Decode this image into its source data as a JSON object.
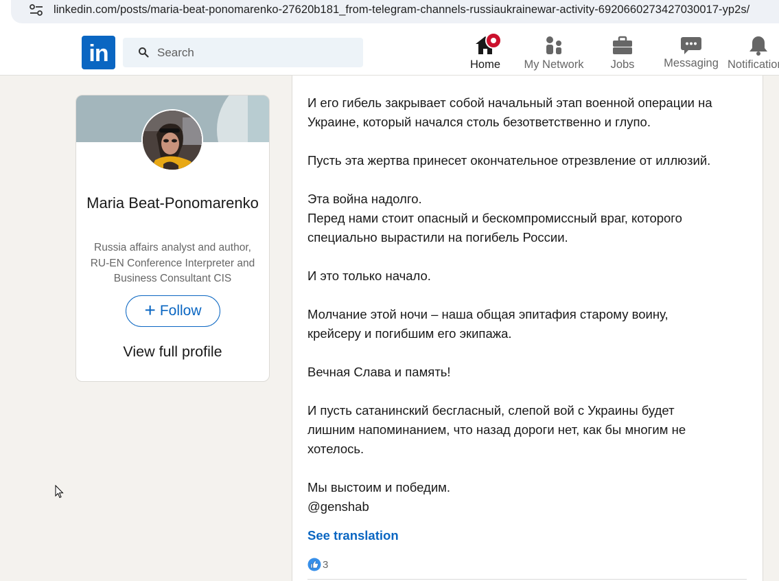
{
  "browser": {
    "url": "linkedin.com/posts/maria-beat-ponomarenko-27620b181_from-telegram-channels-russiaukrainewar-activity-6920660273427030017-yp2s/"
  },
  "header": {
    "logo_text": "in",
    "search_placeholder": "Search",
    "nav": {
      "home": "Home",
      "network": "My Network",
      "jobs": "Jobs",
      "messaging": "Messaging",
      "notifications": "Notifications"
    }
  },
  "profile": {
    "name": "Maria Beat-Ponomarenko",
    "headline": "Russia affairs analyst and author, RU-EN Conference Interpreter and Business Consultant CIS",
    "follow_label": "Follow",
    "view_profile_label": "View full profile"
  },
  "post": {
    "paragraphs": [
      [
        "И его гибель закрывает собой начальный этап военной операции на",
        "Украине, который начался столь безответственно и глупо."
      ],
      [
        "Пусть эта жертва принесет окончательное отрезвление от иллюзий."
      ],
      [
        "Эта война надолго.",
        "Перед нами стоит опасный и бескомпромиссный враг, которого",
        "специально вырастили на погибель России."
      ],
      [
        "И это только начало."
      ],
      [
        "Молчание этой ночи – наша общая эпитафия старому воину,",
        "крейсеру и погибшим его экипажа."
      ],
      [
        "Вечная Слава и память!"
      ],
      [
        "И пусть сатанинский бесгласный, слепой вой с Украины будет",
        "лишним напоминанием, что назад дороги нет, как бы многим не",
        "хотелось."
      ],
      [
        "Мы выстоим и победим.",
        "@genshab"
      ]
    ],
    "see_translation_label": "See translation",
    "reaction_count": "3"
  },
  "colors": {
    "brand": "#0a66c2",
    "badge": "#cb112d",
    "background": "#f4f2ee"
  }
}
